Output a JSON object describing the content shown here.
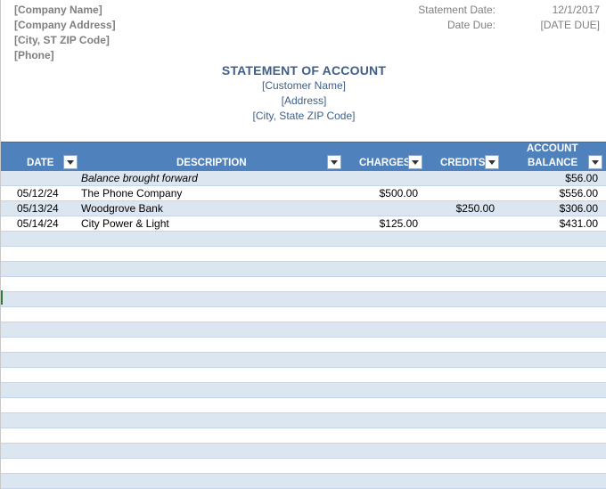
{
  "company": {
    "name": "[Company Name]",
    "address": "[Company Address]",
    "city": "[City, ST  ZIP Code]",
    "phone": "[Phone]"
  },
  "meta": {
    "statement_date_label": "Statement Date:",
    "statement_date_value": "12/1/2017",
    "date_due_label": "Date Due:",
    "date_due_value": "[DATE DUE]"
  },
  "title": "STATEMENT OF ACCOUNT",
  "customer": {
    "name": "[Customer Name]",
    "address": "[Address]",
    "city": "[City, State  ZIP Code]"
  },
  "table": {
    "headers": {
      "date": "DATE",
      "description": "DESCRIPTION",
      "charges": "CHARGES",
      "credits": "CREDITS",
      "balance_line1": "ACCOUNT",
      "balance_line2": "BALANCE"
    },
    "rows": [
      {
        "date": "",
        "description": "Balance brought forward",
        "charges": "",
        "credits": "",
        "balance": "$56.00"
      },
      {
        "date": "05/12/24",
        "description": "The Phone Company",
        "charges": "$500.00",
        "credits": "",
        "balance": "$556.00"
      },
      {
        "date": "05/13/24",
        "description": "Woodgrove Bank",
        "charges": "",
        "credits": "$250.00",
        "balance": "$306.00"
      },
      {
        "date": "05/14/24",
        "description": "City Power & Light",
        "charges": "$125.00",
        "credits": "",
        "balance": "$431.00"
      }
    ]
  },
  "colors": {
    "header_bg": "#4f81bd",
    "band": "#dce6f1",
    "title": "#3e5f8a",
    "muted": "#7f7f7f"
  }
}
